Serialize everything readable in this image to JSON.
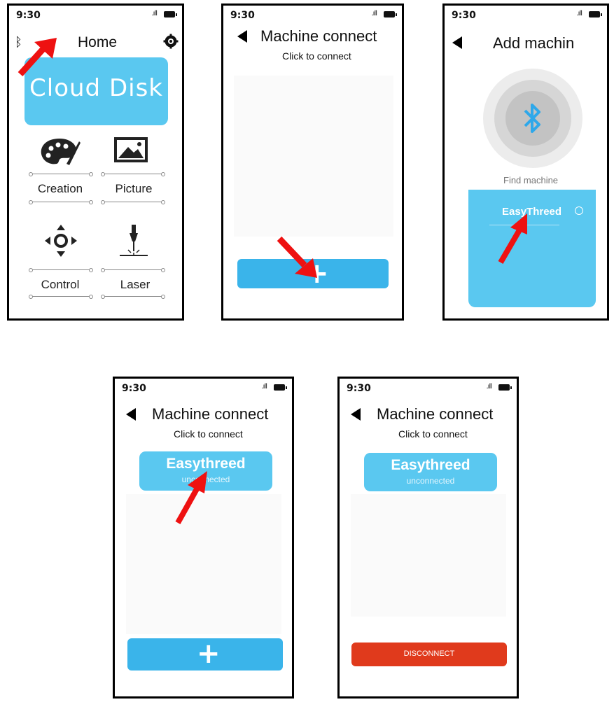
{
  "status": {
    "time": "9:30"
  },
  "screen1": {
    "title": "Home",
    "cloud_disk": "Cloud Disk",
    "tiles": [
      {
        "label": "Creation",
        "icon": "palette-icon"
      },
      {
        "label": "Picture",
        "icon": "image-icon"
      },
      {
        "label": "Control",
        "icon": "move-control-icon"
      },
      {
        "label": "Laser",
        "icon": "laser-icon"
      }
    ]
  },
  "screen2": {
    "title": "Machine connect",
    "subtitle": "Click to connect",
    "add_button": "+"
  },
  "screen3": {
    "title": "Add machin",
    "find_label": "Find machine",
    "device": "EasyThreed"
  },
  "screen4": {
    "title": "Machine connect",
    "subtitle": "Click to connect",
    "device_name": "Easythreed",
    "device_status": "unconnected",
    "add_button": "+"
  },
  "screen5": {
    "title": "Machine connect",
    "subtitle": "Click to connect",
    "device_name": "Easythreed",
    "device_status": "unconnected",
    "disconnect_button": "DISCONNECT"
  },
  "colors": {
    "accent_blue": "#5ac8f0",
    "button_blue": "#3ab4ea",
    "disconnect_red": "#e03a1c",
    "arrow_red": "#ee1111"
  }
}
